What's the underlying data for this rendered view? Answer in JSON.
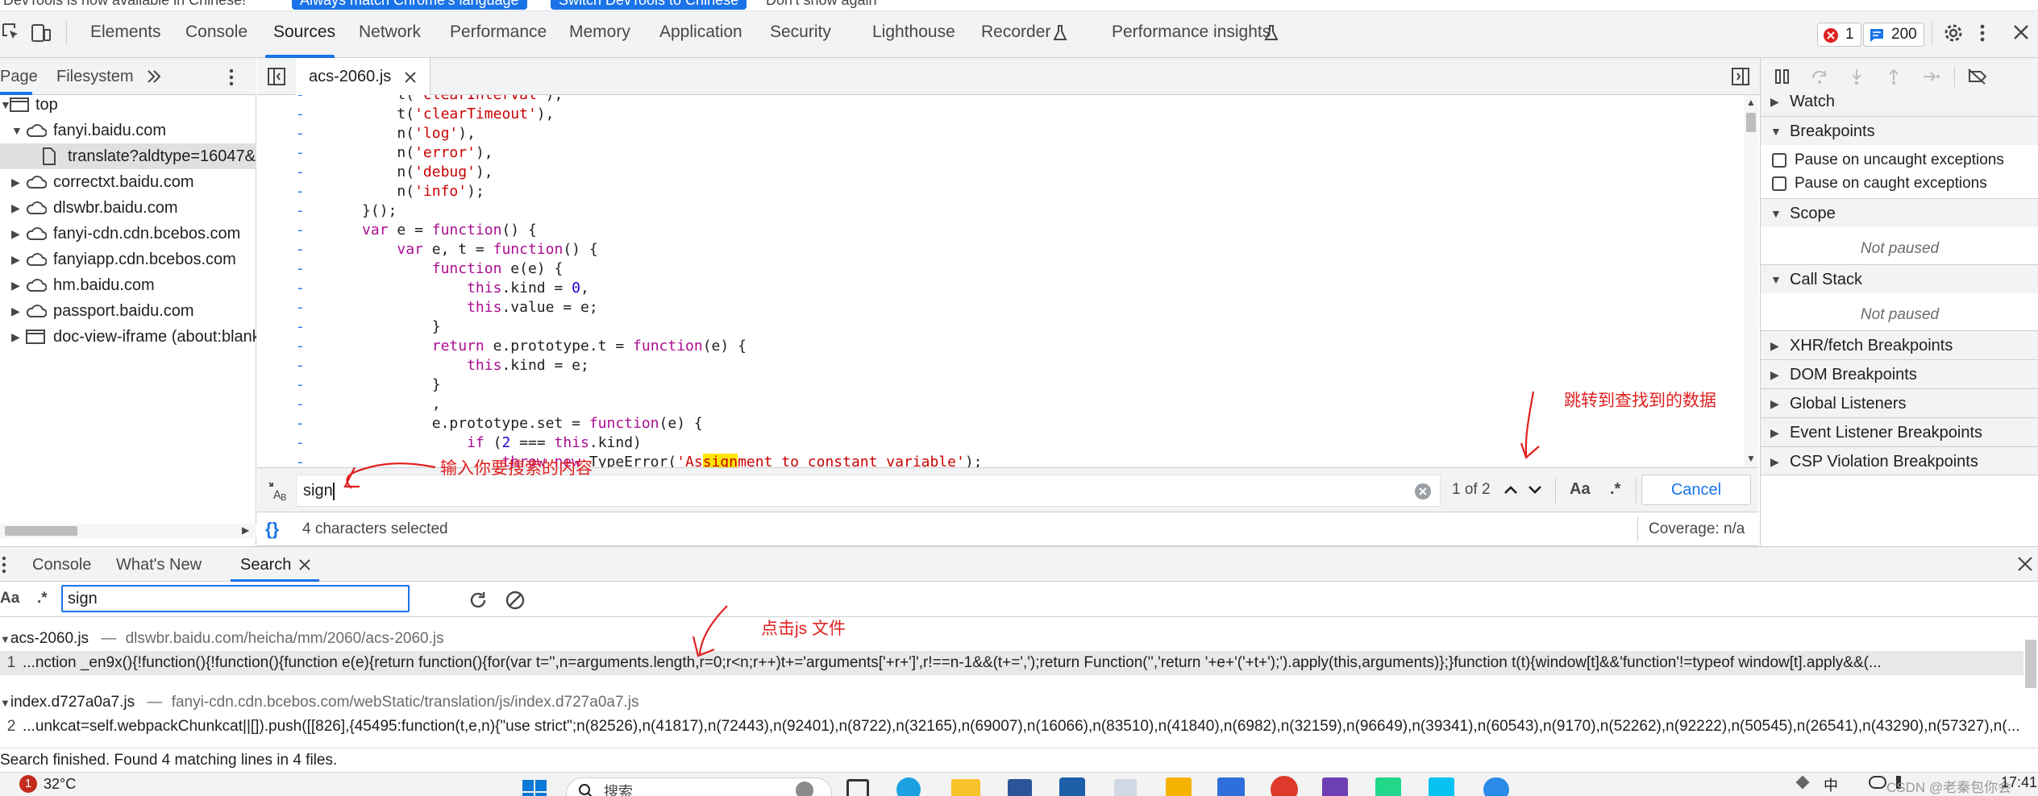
{
  "infobar": {
    "text": "DevTools is now available in Chinese!",
    "btn1": "Always match Chrome's language",
    "btn2": "Switch DevTools to Chinese",
    "dismiss": "Don't show again"
  },
  "tabs": [
    "Elements",
    "Console",
    "Sources",
    "Network",
    "Performance",
    "Memory",
    "Application",
    "Security",
    "Lighthouse",
    "Recorder",
    "Performance insights"
  ],
  "active_tab": "Sources",
  "badges": {
    "errors": "1",
    "messages": "200"
  },
  "navigator": {
    "tabs": [
      "Page",
      "Filesystem"
    ],
    "tree": [
      {
        "label": "top",
        "kind": "frame"
      },
      {
        "label": "fanyi.baidu.com",
        "kind": "cloud"
      },
      {
        "label": "translate?aldtype=16047&",
        "kind": "file"
      },
      {
        "label": "correctxt.baidu.com",
        "kind": "cloud"
      },
      {
        "label": "dlswbr.baidu.com",
        "kind": "cloud"
      },
      {
        "label": "fanyi-cdn.cdn.bcebos.com",
        "kind": "cloud"
      },
      {
        "label": "fanyiapp.cdn.bcebos.com",
        "kind": "cloud"
      },
      {
        "label": "hm.baidu.com",
        "kind": "cloud"
      },
      {
        "label": "passport.baidu.com",
        "kind": "cloud"
      },
      {
        "label": "doc-view-iframe (about:blank)",
        "kind": "frame"
      }
    ]
  },
  "editor": {
    "file": "acs-2060.js",
    "find_query": "sign",
    "match_count": "1 of 2",
    "cancel": "Cancel",
    "case_label": "Aa",
    "regex_label": ".*",
    "selection_status": "4 characters selected",
    "coverage": "Coverage: n/a"
  },
  "debugger": {
    "watch": "Watch",
    "breakpoints": "Breakpoints",
    "pause_uncaught": "Pause on uncaught exceptions",
    "pause_caught": "Pause on caught exceptions",
    "scope": "Scope",
    "not_paused_1": "Not paused",
    "call_stack": "Call Stack",
    "not_paused_2": "Not paused",
    "xhr": "XHR/fetch Breakpoints",
    "dom": "DOM Breakpoints",
    "global": "Global Listeners",
    "event": "Event Listener Breakpoints",
    "csp": "CSP Violation Breakpoints"
  },
  "drawer": {
    "tabs": [
      "Console",
      "What's New",
      "Search"
    ],
    "search_value": "sign",
    "case_label": "Aa",
    "regex_label": ".*",
    "results": [
      {
        "file": "acs-2060.js",
        "url": "dlswbr.baidu.com/heicha/mm/2060/acs-2060.js",
        "line": "1",
        "snippet": "...nction _en9x(){!function(){!function(){function e(e){return function(){for(var t='',n=arguments.length,r=0;r<n;r++)t+='arguments['+r+']',r!==n-1&&(t+=',');return Function('','return '+e+'('+t+');').apply(this,arguments)};}function t(t){window[t]&&'function'!=typeof window[t].apply&&(..."
      },
      {
        "file": "index.d727a0a7.js",
        "url": "fanyi-cdn.cdn.bcebos.com/webStatic/translation/js/index.d727a0a7.js",
        "line": "2",
        "snippet": "...unkcat=self.webpackChunkcat||[]).push([[826],{45495:function(t,e,n){\"use strict\";n(82526),n(41817),n(72443),n(92401),n(8722),n(32165),n(69007),n(16066),n(83510),n(41840),n(6982),n(32159),n(96649),n(39341),n(60543),n(9170),n(52262),n(92222),n(50545),n(26541),n(43290),n(57327),n(..."
      }
    ],
    "status": "Search finished.  Found 4 matching lines in 4 files."
  },
  "annotations": {
    "jump": "跳转到查找到的数据",
    "input": "输入你要搜索的内容",
    "click": "点击js 文件"
  },
  "taskbar": {
    "weather": "32°C",
    "weather_badge": "1",
    "search": "搜索",
    "ime": "中",
    "time": "17:41",
    "watermark": "CSDN @老秦包你会"
  },
  "colors": {
    "accent": "#1a73e8",
    "annotation": "#e02020",
    "highlight": "#ffe600"
  }
}
